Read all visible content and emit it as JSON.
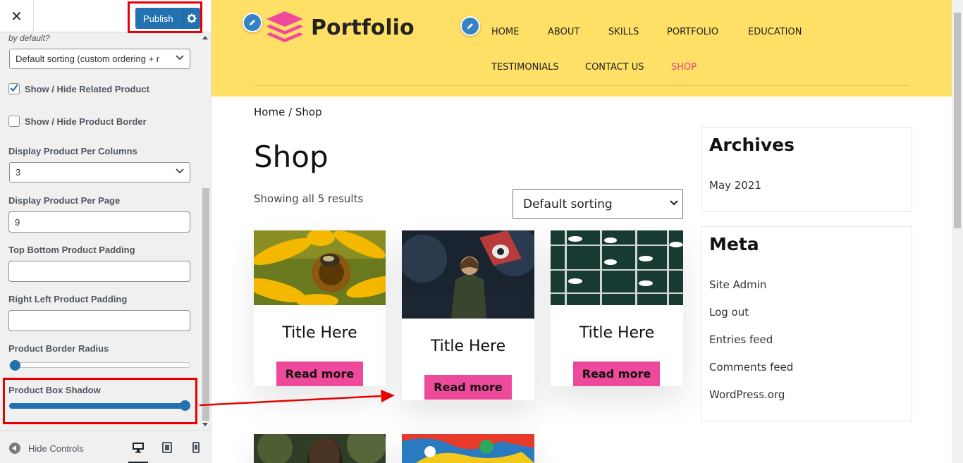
{
  "customizer": {
    "close_label": "✕",
    "publish_label": "Publish",
    "default_hint": "by default?",
    "sorting_value": "Default sorting (custom ordering + r",
    "related_label": "Show / Hide Related Product",
    "related_checked": true,
    "border_label": "Show / Hide Product Border",
    "border_checked": false,
    "per_columns_label": "Display Product Per Columns",
    "per_columns_value": "3",
    "per_page_label": "Display Product Per Page",
    "per_page_value": "9",
    "top_bottom_label": "Top Bottom Product Padding",
    "top_bottom_value": "",
    "right_left_label": "Right Left Product Padding",
    "right_left_value": "",
    "border_radius_label": "Product Border Radius",
    "border_radius_level": 0,
    "box_shadow_label": "Product Box Shadow",
    "box_shadow_level": 1,
    "hide_controls_label": "Hide Controls",
    "devices": [
      "desktop-icon",
      "tablet-icon",
      "mobile-icon"
    ]
  },
  "site": {
    "logo_text": "Portfolio",
    "nav": [
      {
        "label": "HOME"
      },
      {
        "label": "ABOUT"
      },
      {
        "label": "SKILLS"
      },
      {
        "label": "PORTFOLIO"
      },
      {
        "label": "EDUCATION"
      },
      {
        "label": "TESTIMONIALS"
      },
      {
        "label": "CONTACT US"
      },
      {
        "label": "SHOP"
      }
    ],
    "breadcrumb": "Home / Shop",
    "title": "Shop",
    "result_count": "Showing all 5 results",
    "sort_value": "Default sorting",
    "products": [
      {
        "title": "Title Here",
        "button": "Read more",
        "image": "sunflower-bee-image"
      },
      {
        "title": "Title Here",
        "button": "Read more",
        "image": "woman-graffiti-image"
      },
      {
        "title": "Title Here",
        "button": "Read more",
        "image": "boats-dock-image"
      },
      {
        "title": "",
        "button": "",
        "image": "woman-greenery-image"
      },
      {
        "title": "",
        "button": "",
        "image": "abstract-paint-image"
      }
    ],
    "archives_title": "Archives",
    "archives": [
      "May 2021"
    ],
    "meta_title": "Meta",
    "meta_links": [
      "Site Admin",
      "Log out",
      "Entries feed",
      "Comments feed",
      "WordPress.org"
    ]
  },
  "colors": {
    "header_bg": "#ffe066",
    "accent_pink": "#ee4a9b",
    "wp_blue": "#2271b1",
    "highlight_red": "#e60000"
  }
}
